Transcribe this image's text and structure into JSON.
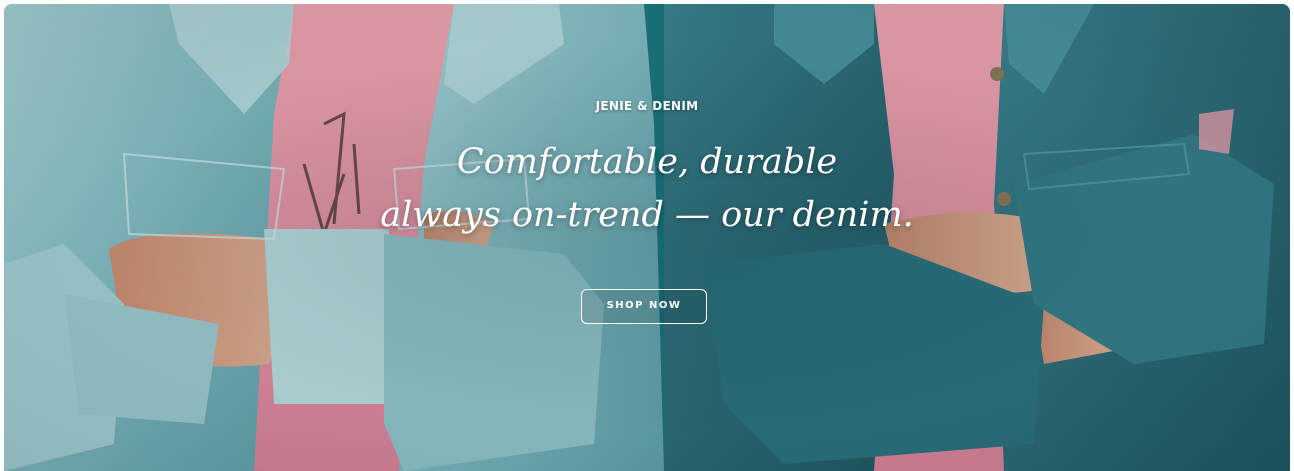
{
  "hero": {
    "eyebrow": "JENIE & DENIM",
    "headline_line1": "Comfortable, durable",
    "headline_line2": "always on-trend — our denim.",
    "cta_label": "SHOP NOW"
  },
  "colors": {
    "background_teal": "#1b7e85",
    "light_denim": "#8cc4cc",
    "dark_denim": "#2f6f7a",
    "pink_shirt": "#e79aa8",
    "skin": "#d9a58a",
    "text": "#ffffff"
  }
}
